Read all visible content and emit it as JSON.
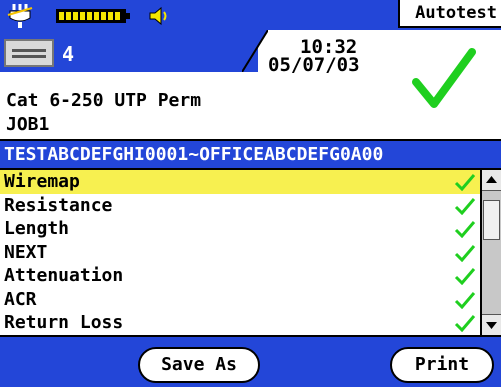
{
  "header": {
    "mode": "Autotest",
    "port": "4",
    "time": "10:32",
    "date": "05/07/03",
    "icons": [
      "plug-icon",
      "battery-icon",
      "speaker-icon",
      "port-icon",
      "pass-check-icon"
    ]
  },
  "test": {
    "cable": "Cat 6-250 UTP Perm",
    "job": "JOB1",
    "id": "TESTABCDEFGHI0001~OFFICEABCDEFG0A00"
  },
  "results": [
    {
      "label": "Wiremap",
      "status": "pass"
    },
    {
      "label": "Resistance",
      "status": "pass"
    },
    {
      "label": "Length",
      "status": "pass"
    },
    {
      "label": "NEXT",
      "status": "pass"
    },
    {
      "label": "Attenuation",
      "status": "pass"
    },
    {
      "label": "ACR",
      "status": "pass"
    },
    {
      "label": "Return Loss",
      "status": "pass"
    }
  ],
  "buttons": {
    "save_as": "Save As",
    "print": "Print"
  },
  "colors": {
    "titlebar": "#2346d8",
    "selected_row": "#f7f050",
    "check": "#1fcf1f"
  }
}
